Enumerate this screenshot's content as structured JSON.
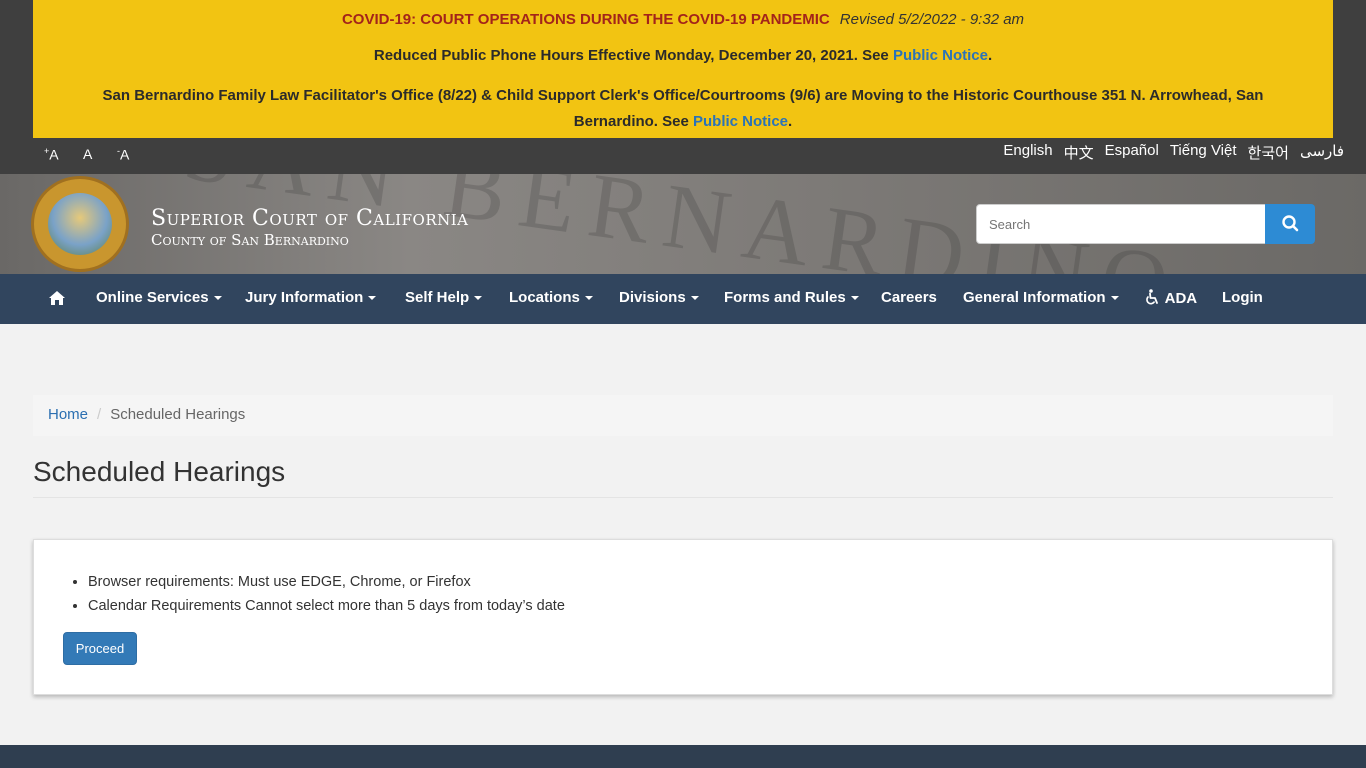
{
  "alert": {
    "covid_title": "COVID-19: COURT OPERATIONS DURING THE COVID-19 PANDEMIC",
    "revised": "Revised 5/2/2022 - 9:32 am",
    "line2_text": "Reduced Public Phone Hours Effective Monday, December 20, 2021. See ",
    "line2_link": "Public Notice",
    "line2_end": ".",
    "line3_text": "San Bernardino Family Law Facilitator's Office (8/22) & Child Support Clerk's Office/Courtrooms (9/6) are Moving to the Historic Courthouse 351 N. Arrowhead, San Bernardino. See ",
    "line3_link": "Public Notice",
    "line3_end": "."
  },
  "font_controls": {
    "increase": "A",
    "normal": "A",
    "decrease": "A",
    "plus": "+",
    "minus": "-"
  },
  "languages": [
    "English",
    "中文",
    "Español",
    "Tiếng Việt",
    "한국어",
    "فارسی"
  ],
  "header": {
    "title": "Superior Court of California",
    "subtitle": "County of San Bernardino",
    "bg_text": "SAN BERNARDINO",
    "search_placeholder": "Search"
  },
  "nav": {
    "items": [
      "Online Services",
      "Jury Information",
      "Self Help",
      "Locations",
      "Divisions",
      "Forms and Rules",
      "Careers",
      "General Information",
      "ADA",
      "Login"
    ]
  },
  "breadcrumb": {
    "home": "Home",
    "current": "Scheduled Hearings"
  },
  "page": {
    "title": "Scheduled Hearings",
    "requirements": [
      "Browser requirements: Must use EDGE, Chrome, or Firefox",
      "Calendar Requirements Cannot select more than 5 days from today’s date"
    ],
    "proceed_label": "Proceed"
  },
  "colors": {
    "banner": "#f2c412",
    "nav": "#31455e",
    "accent": "#2d8bd4",
    "alert_red": "#a3241a"
  }
}
